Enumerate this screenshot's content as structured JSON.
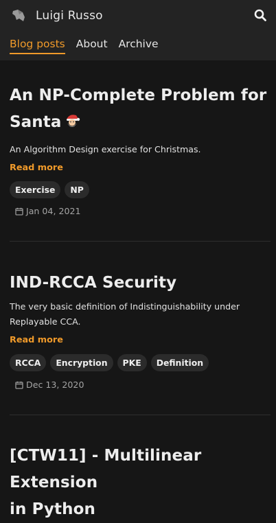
{
  "header": {
    "title": "Luigi Russo",
    "nav": [
      "Blog posts",
      "About",
      "Archive"
    ],
    "logo_icon": "parrot-logo-icon",
    "search_icon": "search-icon"
  },
  "accent_color": "#f09a2a",
  "posts": [
    {
      "title_line1": "An NP-Complete Problem for",
      "title_line2": "Santa",
      "title_emoji_icon": "santa-icon",
      "desc": "An Algorithm Design exercise for Christmas.",
      "read_more": "Read more",
      "tags": [
        "Exercise",
        "NP"
      ],
      "date": "Jan 04, 2021"
    },
    {
      "title_line1": "IND-RCCA Security",
      "desc_line1": "The very basic definition of Indistinguishability under",
      "desc_line2": "Replayable CCA.",
      "read_more": "Read more",
      "tags": [
        "RCCA",
        "Encryption",
        "PKE",
        "Definition"
      ],
      "date": "Dec 13, 2020"
    },
    {
      "title_line1": "[CTW11] - Multilinear Extension",
      "title_line2": "in Python"
    }
  ]
}
